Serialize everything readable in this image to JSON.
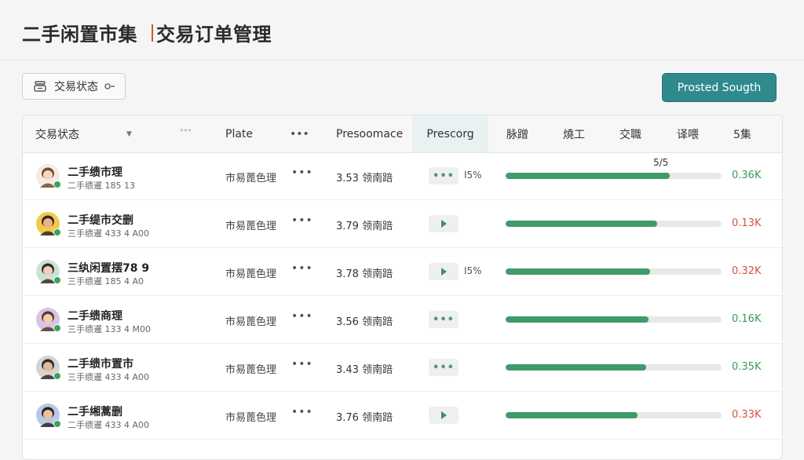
{
  "header": {
    "title_part1": "二手闲置市集",
    "title_part2": "交易订单管理"
  },
  "toolbar": {
    "filter_label": "交易状态",
    "primary_button": "Prosted Sougth"
  },
  "colors": {
    "accent": "#2f8a8e",
    "progress": "#3f9b67",
    "positive": "#3a9a5a",
    "negative": "#d2553a"
  },
  "table": {
    "columns": [
      {
        "label": "交易状态"
      },
      {
        "label": "˚˚˚"
      },
      {
        "label": "Plate"
      },
      {
        "label": "•••"
      },
      {
        "label": "Presoomace"
      },
      {
        "label": "Prescorg"
      },
      {
        "label": "脉蹭"
      },
      {
        "label": "燒工"
      },
      {
        "label": "交職"
      },
      {
        "label": "译喂"
      },
      {
        "label": "5集"
      }
    ],
    "rows": [
      {
        "name": "二手缋市理",
        "sub": "二手缋暹 185 13",
        "plate": "市易蓖色理",
        "dots": "•••",
        "price": "3.53 领南踣",
        "chip": "more",
        "pct": "I5%",
        "progress": 0.76,
        "bar_label": "5/5",
        "amount": "0.36K",
        "amount_kind": "positive",
        "avatar": {
          "skin": "#f4d7c2",
          "hair": "#7a4a2b",
          "bg": "#f3ece6"
        }
      },
      {
        "name": "二手缇市交删",
        "sub": "三手缋暹 433 4 A00",
        "plate": "市易蓖色理",
        "dots": "•••",
        "price": "3.79 领南踣",
        "chip": "play",
        "pct": "",
        "progress": 0.7,
        "bar_label": "",
        "amount": "0.13K",
        "amount_kind": "negative",
        "avatar": {
          "skin": "#e9b48a",
          "hair": "#2d2a2a",
          "bg": "#f2c94c"
        }
      },
      {
        "name": "三纨闲置摆78 9",
        "sub": "三手缋暹 185 4 A0",
        "plate": "市易蓖色理",
        "dots": "•••",
        "price": "3.78 领南踣",
        "chip": "play",
        "pct": "I5%",
        "progress": 0.67,
        "bar_label": "",
        "amount": "0.32K",
        "amount_kind": "negative",
        "avatar": {
          "skin": "#efcfb6",
          "hair": "#3b2b22",
          "bg": "#c9e3d9"
        }
      },
      {
        "name": "二手缋商理",
        "sub": "三手缋暹 133 4 M00",
        "plate": "市易蓖色理",
        "dots": "•••",
        "price": "3.56 领南踣",
        "chip": "more",
        "pct": "",
        "progress": 0.66,
        "bar_label": "",
        "amount": "0.16K",
        "amount_kind": "positive",
        "avatar": {
          "skin": "#f0cdb4",
          "hair": "#5a3a2a",
          "bg": "#d8c4e6"
        }
      },
      {
        "name": "二手缋市置市",
        "sub": "三手缋暹 433 4 A00",
        "plate": "市易蓖色理",
        "dots": "•••",
        "price": "3.43 领南踣",
        "chip": "more",
        "pct": "",
        "progress": 0.65,
        "bar_label": "",
        "amount": "0.35K",
        "amount_kind": "positive",
        "avatar": {
          "skin": "#e4b996",
          "hair": "#2e2a28",
          "bg": "#d4d4d4"
        }
      },
      {
        "name": "二手缃蒿删",
        "sub": "二手缋暹 433 4 A00",
        "plate": "市易蓖色理",
        "dots": "•••",
        "price": "3.76 领南踣",
        "chip": "play",
        "pct": "",
        "progress": 0.61,
        "bar_label": "",
        "amount": "0.33K",
        "amount_kind": "negative",
        "avatar": {
          "skin": "#eac1a0",
          "hair": "#2b2320",
          "bg": "#b9c7e8"
        }
      }
    ]
  }
}
